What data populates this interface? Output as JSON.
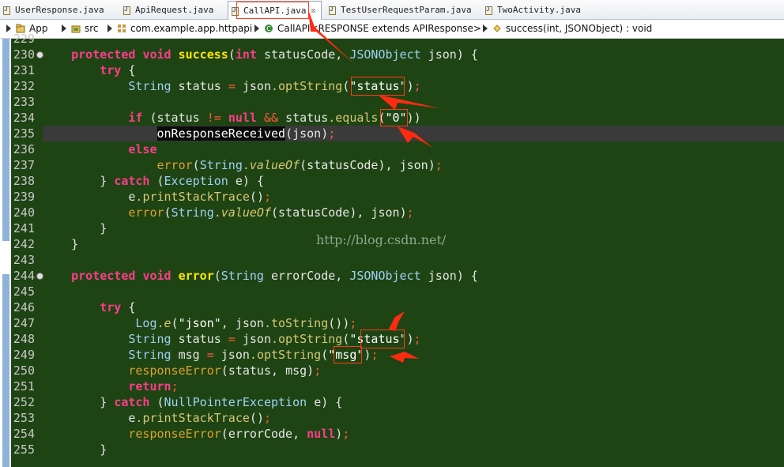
{
  "tabs": [
    {
      "label": "UserResponse.java",
      "active": false
    },
    {
      "label": "ApiRequest.java",
      "active": false
    },
    {
      "label": "CallAPI.java",
      "active": true
    },
    {
      "label": "TestUserRequestParam.java",
      "active": false
    },
    {
      "label": "TwoActivity.java",
      "active": false
    }
  ],
  "close_glyph": "☒",
  "breadcrumb": [
    {
      "label": "App",
      "icon": "project-icon"
    },
    {
      "label": "src",
      "icon": "source-folder-icon"
    },
    {
      "label": "com.example.app.httpapi",
      "icon": "package-icon"
    },
    {
      "label": "CallAPI<RESPONSE extends APIResponse>",
      "icon": "class-icon"
    },
    {
      "label": "success(int, JSONObject) : void",
      "icon": "method-icon"
    }
  ],
  "editor": {
    "first_line_partial": "229",
    "watermark": "http://blog.csdn.net/",
    "line_numbers": [
      "230",
      "231",
      "232",
      "233",
      "234",
      "235",
      "236",
      "237",
      "238",
      "239",
      "240",
      "241",
      "242",
      "243",
      "244",
      "245",
      "246",
      "247",
      "248",
      "249",
      "250",
      "251",
      "252",
      "253",
      "254",
      "255"
    ],
    "current_line": "235",
    "code_lines": [
      "    protected void success(int statusCode, JSONObject json) {",
      "        try {",
      "            String status = json.optString(\"status\");",
      "",
      "            if (status != null && status.equals(\"0\"))",
      "                onResponseReceived(json);",
      "            else",
      "                error(String.valueOf(statusCode), json);",
      "        } catch (Exception e) {",
      "            e.printStackTrace();",
      "            error(String.valueOf(statusCode), json);",
      "        }",
      "    }",
      "",
      "    protected void error(String errorCode, JSONObject json) {",
      "",
      "        try {",
      "             Log.e(\"json\", json.toString());",
      "            String status = json.optString(\"status\");",
      "            String msg = json.optString(\"msg\");",
      "            responseError(status, msg);",
      "            return;",
      "        } catch (NullPointerException e) {",
      "            e.printStackTrace();",
      "            responseError(errorCode, null);",
      "        }"
    ]
  },
  "colors": {
    "editor_background": "#1e4413",
    "keyword": "#ff3c8c",
    "method_declaration": "#ffe600",
    "type": "#9fd0f4",
    "annotation_red": "#ff3b1a"
  }
}
